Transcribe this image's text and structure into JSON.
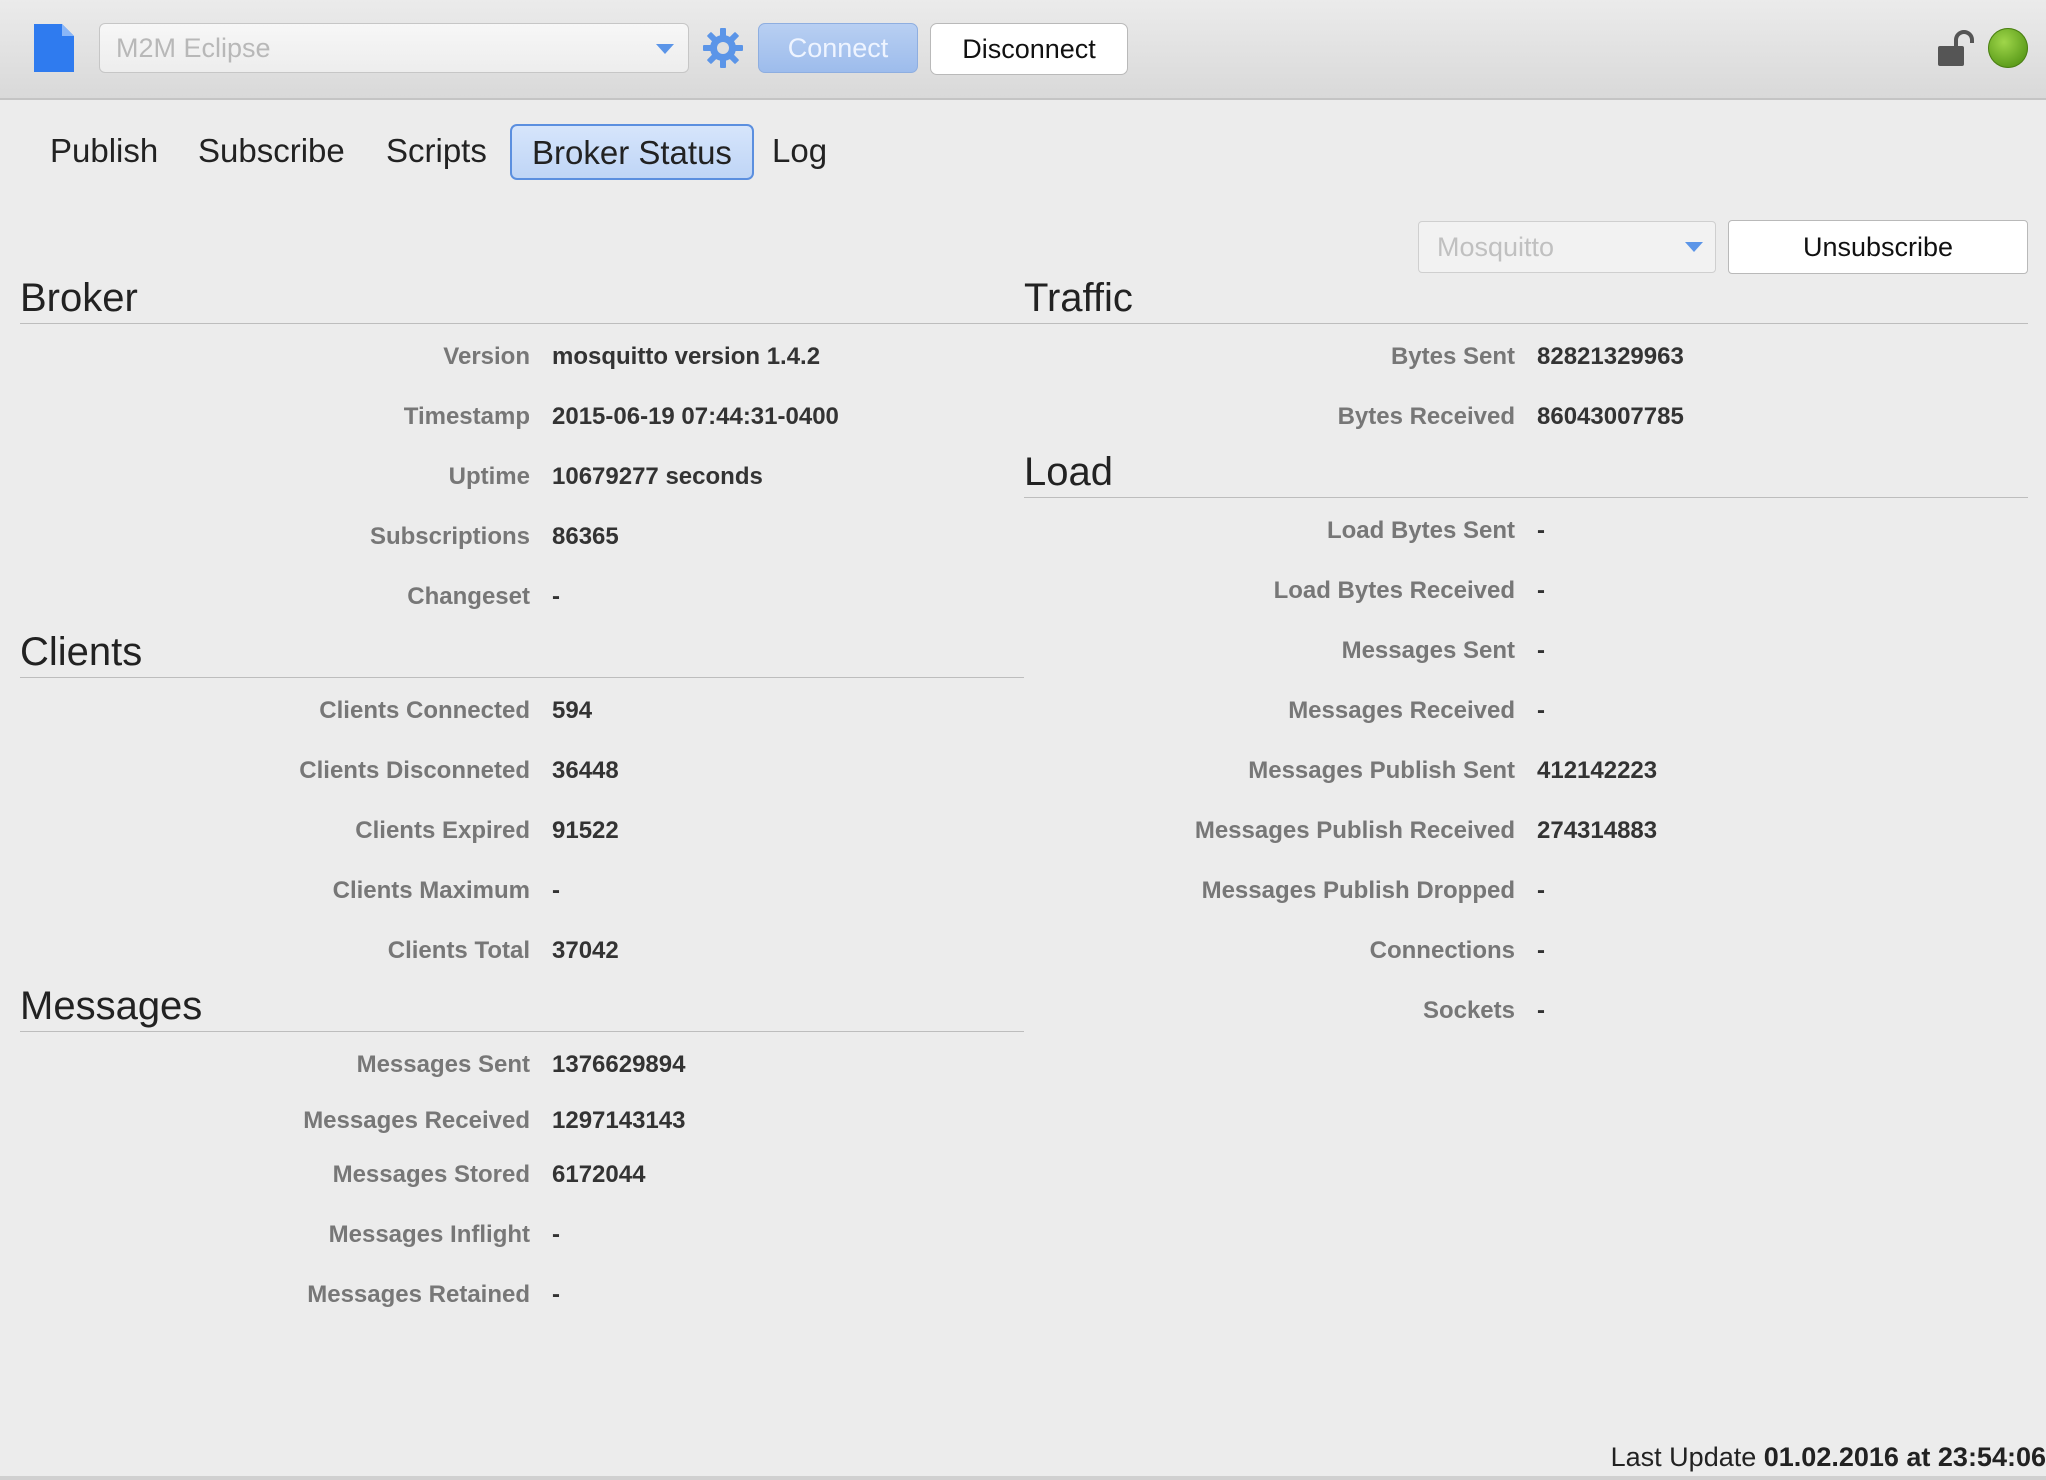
{
  "toolbar": {
    "broker_placeholder": "M2M Eclipse",
    "connect_label": "Connect",
    "disconnect_label": "Disconnect",
    "status_color": "#6fb22a",
    "accent_color": "#5b8fdf"
  },
  "tabs": [
    {
      "label": "Publish",
      "active": false
    },
    {
      "label": "Subscribe",
      "active": false
    },
    {
      "label": "Scripts",
      "active": false
    },
    {
      "label": "Broker Status",
      "active": true
    },
    {
      "label": "Log",
      "active": false
    }
  ],
  "controls": {
    "topic_select_value": "Mosquitto",
    "unsubscribe_label": "Unsubscribe"
  },
  "broker": {
    "title": "Broker",
    "rows": [
      {
        "label": "Version",
        "value": "mosquitto version 1.4.2"
      },
      {
        "label": "Timestamp",
        "value": "2015-06-19 07:44:31-0400"
      },
      {
        "label": "Uptime",
        "value": "10679277 seconds"
      },
      {
        "label": "Subscriptions",
        "value": "86365"
      },
      {
        "label": "Changeset",
        "value": "-"
      }
    ]
  },
  "clients": {
    "title": "Clients",
    "rows": [
      {
        "label": "Clients Connected",
        "value": "594"
      },
      {
        "label": "Clients Disconneted",
        "value": "36448"
      },
      {
        "label": "Clients Expired",
        "value": "91522"
      },
      {
        "label": "Clients Maximum",
        "value": "-"
      },
      {
        "label": "Clients Total",
        "value": "37042"
      }
    ]
  },
  "messages": {
    "title": "Messages",
    "rows": [
      {
        "label": "Messages Sent",
        "value": "1376629894"
      },
      {
        "label": "Messages Received",
        "value": "1297143143"
      },
      {
        "label": "Messages Stored",
        "value": "6172044"
      },
      {
        "label": "Messages Inflight",
        "value": "-"
      },
      {
        "label": "Messages Retained",
        "value": "-"
      }
    ]
  },
  "traffic": {
    "title": "Traffic",
    "rows": [
      {
        "label": "Bytes Sent",
        "value": "82821329963"
      },
      {
        "label": "Bytes Received",
        "value": "86043007785"
      }
    ]
  },
  "load": {
    "title": "Load",
    "rows": [
      {
        "label": "Load Bytes Sent",
        "value": "-"
      },
      {
        "label": "Load Bytes Received",
        "value": "-"
      },
      {
        "label": "Messages Sent",
        "value": "-"
      },
      {
        "label": "Messages Received",
        "value": "-"
      },
      {
        "label": "Messages Publish Sent",
        "value": "412142223"
      },
      {
        "label": "Messages Publish Received",
        "value": "274314883"
      },
      {
        "label": "Messages Publish Dropped",
        "value": "-"
      },
      {
        "label": "Connections",
        "value": "-"
      },
      {
        "label": "Sockets",
        "value": "-"
      }
    ]
  },
  "footer": {
    "label": "Last Update",
    "value": "01.02.2016 at 23:54:06"
  }
}
